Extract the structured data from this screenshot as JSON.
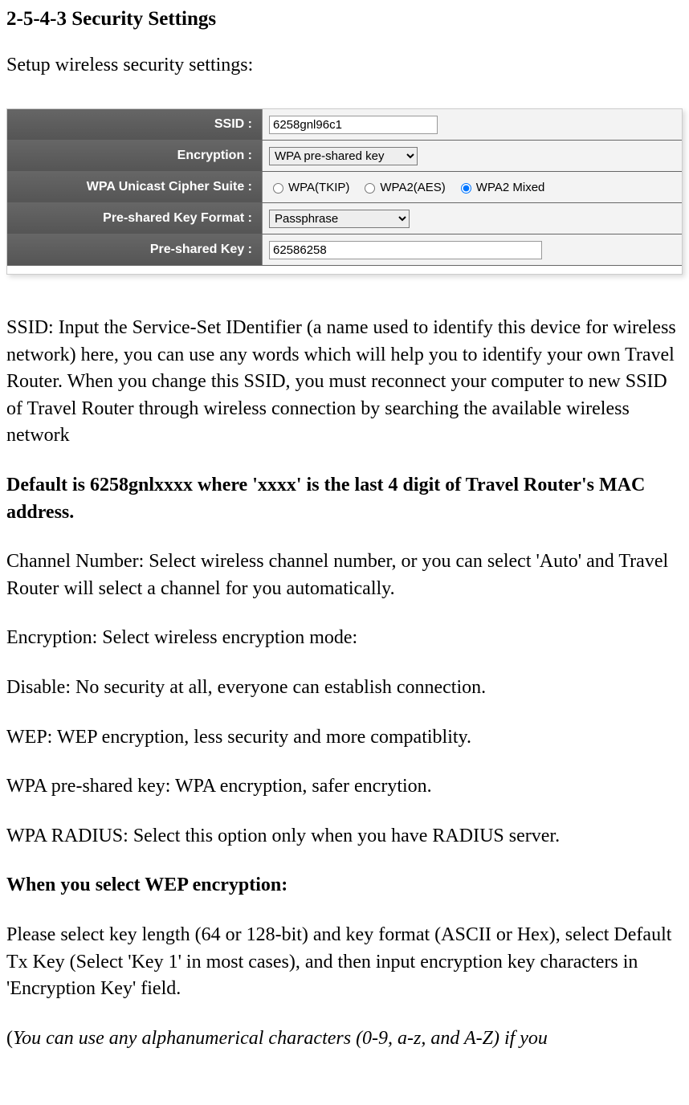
{
  "heading": "2-5-4-3 Security Settings",
  "intro": "Setup wireless security settings:",
  "settings": {
    "ssid_label": "SSID :",
    "ssid_value": "6258gnl96c1",
    "encryption_label": "Encryption :",
    "encryption_value": "WPA pre-shared key",
    "cipher_label": "WPA Unicast Cipher Suite :",
    "cipher_opt1": "WPA(TKIP)",
    "cipher_opt2": "WPA2(AES)",
    "cipher_opt3": "WPA2 Mixed",
    "cipher_selected": "WPA2 Mixed",
    "format_label": "Pre-shared Key Format :",
    "format_value": "Passphrase",
    "key_label": "Pre-shared Key :",
    "key_value": "62586258"
  },
  "paras": {
    "ssid_desc": "SSID: Input the Service-Set IDentifier (a name used to identify this device for wireless network) here, you can use any words which will help you to identify your own Travel Router. When you change this SSID, you must reconnect your computer to new SSID of Travel Router through wireless connection by searching the available wireless network",
    "ssid_default_bold": "Default is 6258gnlxxxx where 'xxxx' is the last 4 digit of Travel Router's MAC address.",
    "channel_desc": "Channel Number: Select wireless channel number, or you can select 'Auto' and Travel Router will select a channel for you automatically.",
    "encryption_intro": "Encryption: Select wireless encryption mode:",
    "enc_disable": "Disable: No security at all, everyone can establish connection.",
    "enc_wep": "WEP: WEP encryption, less security and more compatiblity.",
    "enc_wpa": "WPA pre-shared key: WPA encryption, safer encrytion.",
    "enc_radius": "WPA RADIUS: Select this option only when you have RADIUS server.",
    "wep_heading": "When you select WEP encryption:",
    "wep_desc": "Please select key length (64 or 128-bit) and key format (ASCII or Hex), select Default Tx Key (Select 'Key 1' in most cases), and then input encryption key characters in 'Encryption Key' field.",
    "note_prefix": "(",
    "note_italic": "You can use any alphanumerical characters (0-9, a-z, and A-Z) if you"
  }
}
